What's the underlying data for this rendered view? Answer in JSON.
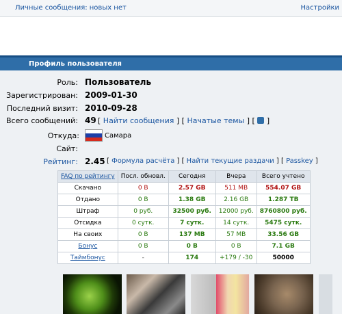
{
  "topbar": {
    "private_messages": "Личные сообщения: новых нет",
    "settings": "Настройки"
  },
  "panel": {
    "title": "Профиль пользователя"
  },
  "profile": {
    "role_label": "Роль:",
    "role_value": "Пользователь",
    "registered_label": "Зарегистрирован:",
    "registered_value": "2009-01-30",
    "last_visit_label": "Последний визит:",
    "last_visit_value": "2010-09-28",
    "posts_label": "Всего сообщений:",
    "posts_value": "49",
    "find_posts": "Найти сообщения",
    "started_topics": "Начатые темы",
    "from_label": "Откуда:",
    "from_value": "Самара",
    "site_label": "Сайт:",
    "rating_label": "Рейтинг:",
    "rating_value": "2.45",
    "formula": "Формула расчёта",
    "find_distributions": "Найти текущие раздачи",
    "passkey": "Passkey",
    "flag_colors": [
      "#ffffff",
      "#1c3fa8",
      "#d52b1e"
    ]
  },
  "stats": {
    "headers": [
      "FAQ по рейтингу",
      "Посл. обновл.",
      "Сегодня",
      "Вчера",
      "Всего учтено"
    ],
    "rows": [
      {
        "label": "Скачано",
        "cells": [
          "0 B",
          "2.57 GB",
          "511 MB",
          "554.07 GB"
        ]
      },
      {
        "label": "Отдано",
        "cells": [
          "0 B",
          "1.38 GB",
          "2.16 GB",
          "1.287 TB"
        ]
      },
      {
        "label": "Штраф",
        "cells": [
          "0 руб.",
          "32500 руб.",
          "12000 руб.",
          "8760800 руб."
        ]
      },
      {
        "label": "Отсидка",
        "cells": [
          "0 сутк.",
          "7 сутк.",
          "14 сутк.",
          "5475 сутк."
        ]
      },
      {
        "label": "На своих",
        "cells": [
          "0 B",
          "137 MB",
          "57 MB",
          "33.56 GB"
        ]
      },
      {
        "label": "Бонус",
        "cells": [
          "0 B",
          "0 B",
          "0 B",
          "7.1 GB"
        ]
      },
      {
        "label": "Таймбонус",
        "cells": [
          "-",
          "174",
          "+179 / -30",
          "50000"
        ]
      }
    ]
  },
  "thumbnails": [
    "sun-thumbnail",
    "hands-thumbnail",
    "woman-thumbnail",
    "blonde-thumbnail",
    "hedgehog-thumbnail"
  ]
}
